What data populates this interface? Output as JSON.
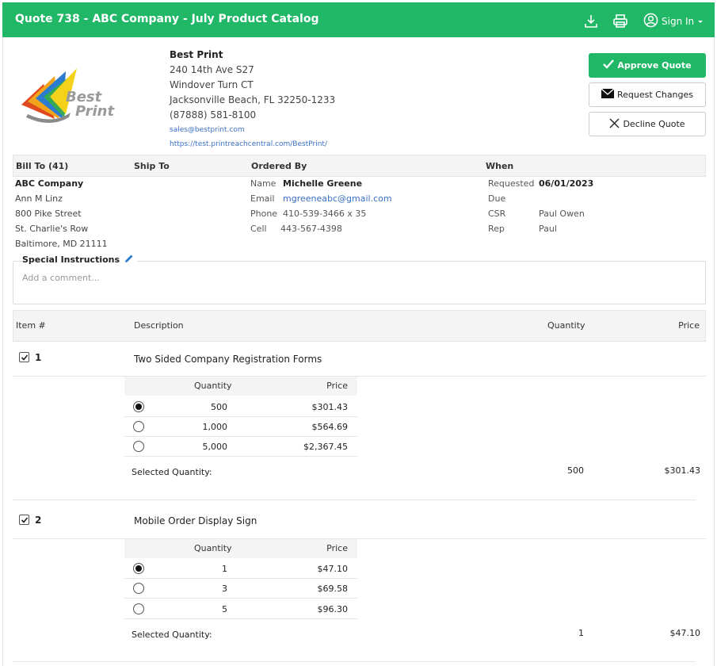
{
  "header": {
    "title": "Quote 738 - ABC Company - July Product Catalog",
    "sign_in_label": "Sign In",
    "icons": [
      "download-icon",
      "print-icon",
      "user-circle-icon",
      "caret-down-icon"
    ]
  },
  "company": {
    "logo_text_line1": "Best",
    "logo_text_line2": "Print",
    "name": "Best Print",
    "address1": "240 14th Ave S27",
    "address2": "Windover Turn CT",
    "city_state_zip": "Jacksonville Beach, FL 32250-1233",
    "phone": "(87888) 581-8100",
    "email": "sales@bestprint.com",
    "website": "https://test.printreachcentral.com/BestPrint/"
  },
  "actions": {
    "approve_label": "Approve Quote",
    "request_label": "Request Changes",
    "decline_label": "Decline Quote"
  },
  "info_header": {
    "bill_to": "Bill To (41)",
    "ship_to": "Ship To",
    "ordered_by": "Ordered By",
    "when": "When"
  },
  "bill_to": {
    "company": "ABC Company",
    "contact": "Ann M Linz",
    "address1": "800 Pike Street",
    "address2": "St. Charlie's Row",
    "city_state_zip": "Baltimore, MD 21111"
  },
  "ordered_by": {
    "name_label": "Name",
    "name": "Michelle Greene",
    "email_label": "Email",
    "email": "mgreeneabc@gmail.com",
    "phone_label": "Phone",
    "phone": "410-539-3466 x 35",
    "cell_label": "Cell",
    "cell": "443-567-4398"
  },
  "when": {
    "requested_label": "Requested",
    "requested": "06/01/2023",
    "due_label": "Due",
    "due": "",
    "csr_label": "CSR",
    "csr": "Paul Owen",
    "rep_label": "Rep",
    "rep": "Paul"
  },
  "special_instructions": {
    "label": "Special Instructions",
    "placeholder": "Add a comment..."
  },
  "items_header": {
    "item": "Item #",
    "description": "Description",
    "quantity": "Quantity",
    "price": "Price"
  },
  "qty_table_header": {
    "quantity": "Quantity",
    "price": "Price"
  },
  "selected_label": "Selected Quantity:",
  "items": [
    {
      "number": "1",
      "description": "Two Sided Company Registration Forms",
      "options": [
        {
          "quantity": "500",
          "price": "$301.43",
          "selected": true
        },
        {
          "quantity": "1,000",
          "price": "$564.69",
          "selected": false
        },
        {
          "quantity": "5,000",
          "price": "$2,367.45",
          "selected": false
        }
      ],
      "selected_quantity": "500",
      "selected_price": "$301.43"
    },
    {
      "number": "2",
      "description": "Mobile Order Display Sign",
      "options": [
        {
          "quantity": "1",
          "price": "$47.10",
          "selected": true
        },
        {
          "quantity": "3",
          "price": "$69.58",
          "selected": false
        },
        {
          "quantity": "5",
          "price": "$96.30",
          "selected": false
        }
      ],
      "selected_quantity": "1",
      "selected_price": "$47.10"
    }
  ]
}
